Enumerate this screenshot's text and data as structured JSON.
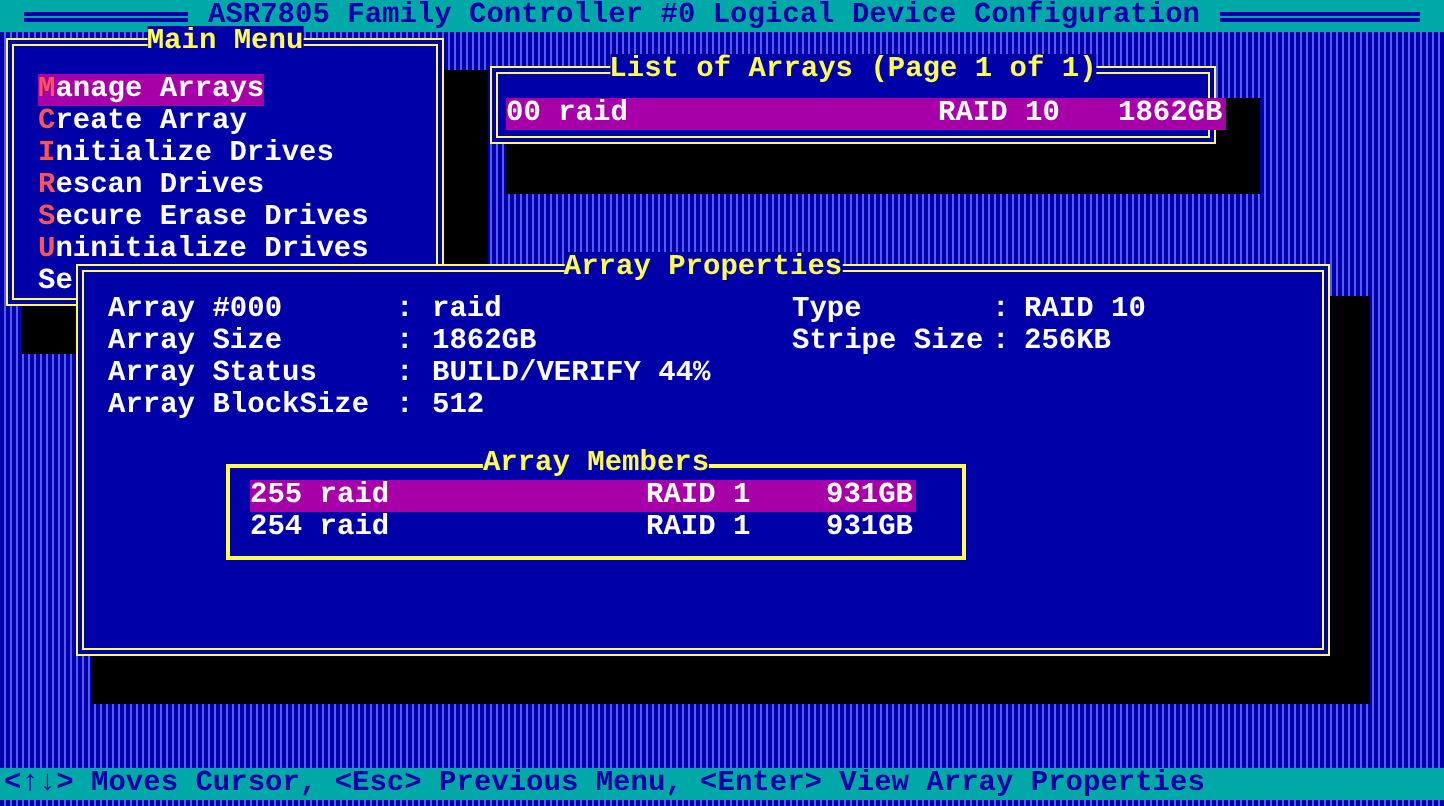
{
  "title_bar": {
    "title": "ASR7805 Family Controller #0 Logical Device Configuration"
  },
  "main_menu": {
    "title": "Main Menu",
    "items": [
      {
        "hotkey": "M",
        "label": "anage Arrays",
        "selected": true
      },
      {
        "hotkey": "C",
        "label": "reate Array",
        "selected": false
      },
      {
        "hotkey": "I",
        "label": "nitialize Drives",
        "selected": false
      },
      {
        "hotkey": "R",
        "label": "escan Drives",
        "selected": false
      },
      {
        "hotkey": "S",
        "label": "ecure Erase Drives",
        "selected": false
      },
      {
        "hotkey": "U",
        "label": "ninitialize Drives",
        "selected": false
      },
      {
        "label": "Se",
        "selected": false
      }
    ]
  },
  "array_list": {
    "title": "List of Arrays (Page 1 of 1)",
    "rows": [
      {
        "name": "00 raid",
        "level": "RAID 10",
        "size": "1862GB",
        "selected": true
      }
    ]
  },
  "array_properties": {
    "title": "Array Properties",
    "fields": [
      {
        "label": "Array #000",
        "separator": ":",
        "value": "raid"
      },
      {
        "label": "Array Size",
        "separator": ":",
        "value": "1862GB"
      },
      {
        "label": "Array Status",
        "separator": ":",
        "value": "BUILD/VERIFY 44%"
      },
      {
        "label": "Array BlockSize",
        "separator": ":",
        "value": "512"
      }
    ],
    "side_fields": [
      {
        "label": "Type",
        "separator": ":",
        "value": "RAID 10"
      },
      {
        "label": "Stripe Size",
        "separator": ":",
        "value": "256KB"
      }
    ],
    "members": {
      "title": "Array Members",
      "rows": [
        {
          "name": "255 raid",
          "level": "RAID 1",
          "size": "931GB",
          "selected": true
        },
        {
          "name": "254 raid",
          "level": "RAID 1",
          "size": "931GB",
          "selected": false
        }
      ]
    }
  },
  "status_bar": {
    "text": "<↑↓> Moves Cursor, <Esc> Previous Menu, <Enter> View Array Properties"
  }
}
